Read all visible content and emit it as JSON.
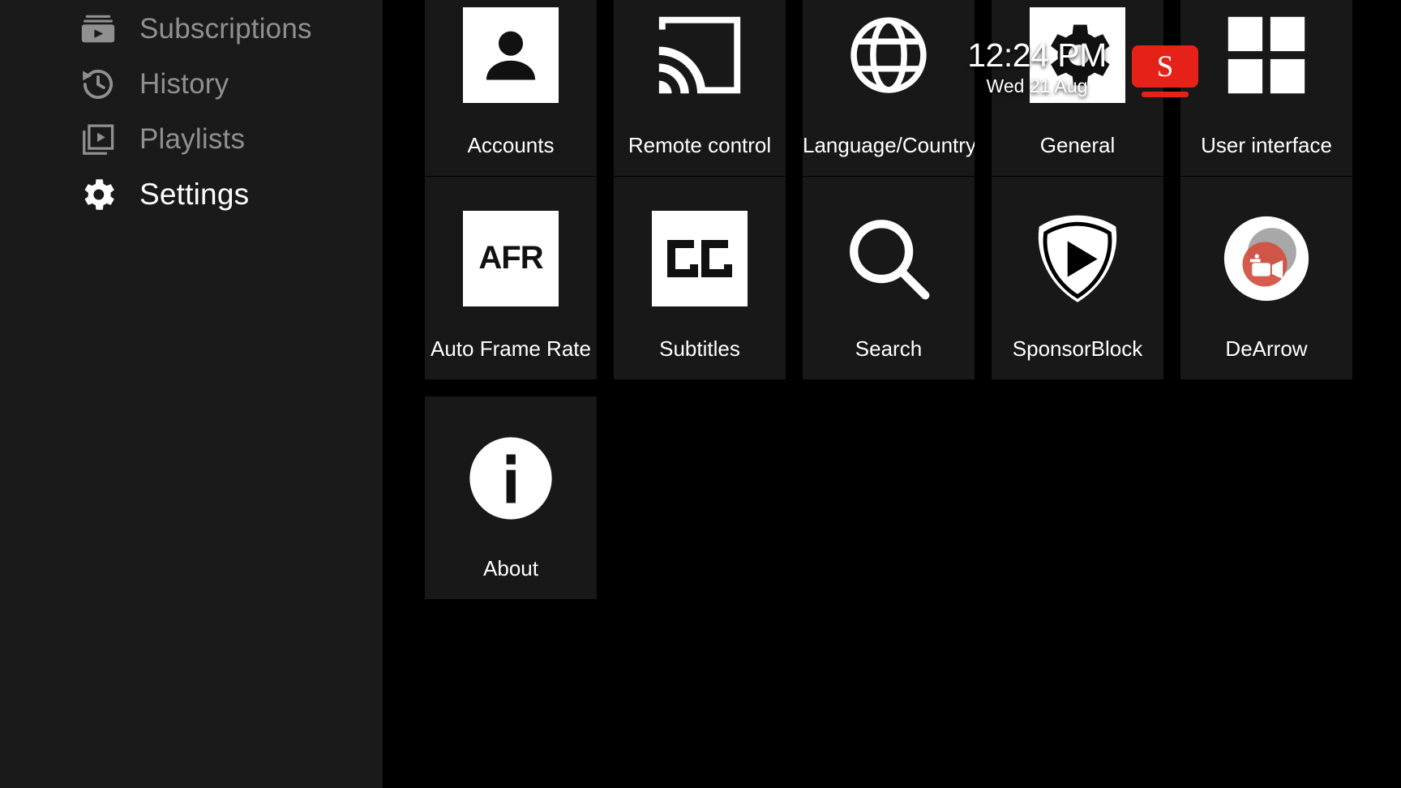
{
  "sidebar": {
    "items": [
      {
        "label": "Subscriptions",
        "icon": "subscriptions-icon",
        "active": false
      },
      {
        "label": "History",
        "icon": "history-icon",
        "active": false
      },
      {
        "label": "Playlists",
        "icon": "playlists-icon",
        "active": false
      },
      {
        "label": "Settings",
        "icon": "gear-icon",
        "active": true
      }
    ]
  },
  "clock": {
    "time": "12:24 PM",
    "date": "Wed 21 Aug"
  },
  "logo_badge": {
    "letter": "S",
    "color": "#e62117"
  },
  "colors": {
    "sidebar_bg": "#1a1a1a",
    "main_bg": "#000000",
    "tile_bg": "#181818",
    "label_inactive": "#909090",
    "label_active": "#ffffff",
    "accent_red": "#e62117",
    "dearrow_red": "#d34f3f",
    "dearrow_gray": "#a8a8a8"
  },
  "grid": {
    "rows": [
      [
        {
          "label": "Accounts",
          "icon": "person-icon"
        },
        {
          "label": "Remote control",
          "icon": "cast-icon"
        },
        {
          "label": "Language/Country",
          "icon": "globe-icon"
        },
        {
          "label": "General",
          "icon": "gear-icon"
        },
        {
          "label": "User interface",
          "icon": "grid-icon"
        }
      ],
      [
        {
          "label": "Auto Frame Rate",
          "icon": "afr-icon"
        },
        {
          "label": "Subtitles",
          "icon": "cc-icon"
        },
        {
          "label": "Search",
          "icon": "search-icon"
        },
        {
          "label": "SponsorBlock",
          "icon": "shield-play-icon"
        },
        {
          "label": "DeArrow",
          "icon": "dearrow-icon"
        }
      ],
      [
        {
          "label": "About",
          "icon": "info-icon"
        }
      ]
    ],
    "afr_text": "AFR",
    "cc_text": "CC"
  }
}
